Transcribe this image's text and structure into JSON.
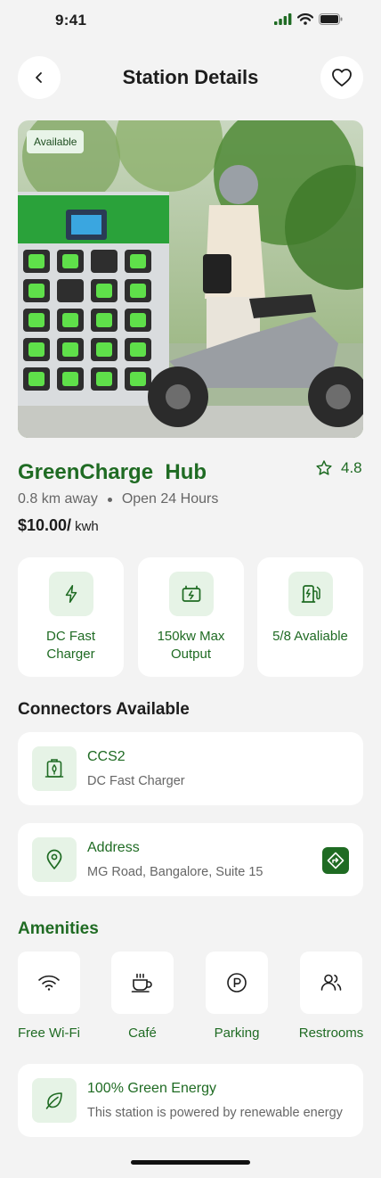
{
  "status_bar": {
    "time": "9:41"
  },
  "header": {
    "title": "Station Details"
  },
  "hero": {
    "badge": "Available"
  },
  "station": {
    "name": "GreenCharge  Hub",
    "rating": "4.8",
    "distance": "0.8 km away",
    "hours": "Open 24 Hours",
    "price": "$10.00/",
    "price_unit": "kwh"
  },
  "features": [
    {
      "icon": "lightning-icon",
      "label": "DC Fast Charger"
    },
    {
      "icon": "battery-icon",
      "label": "150kw Max Output"
    },
    {
      "icon": "ev-charger-icon",
      "label": "5/8 Avaliable"
    }
  ],
  "connectors": {
    "title": "Connectors Available",
    "items": [
      {
        "icon": "connector-icon",
        "name": "CCS2",
        "type": "DC Fast Charger"
      }
    ]
  },
  "address": {
    "label": "Address",
    "value": "MG Road, Bangalore, Suite 15"
  },
  "amenities": {
    "title": "Amenities",
    "items": [
      {
        "icon": "wifi-icon",
        "label": "Free Wi-Fi"
      },
      {
        "icon": "coffee-icon",
        "label": "Café"
      },
      {
        "icon": "parking-icon",
        "label": "Parking"
      },
      {
        "icon": "restroom-icon",
        "label": "Restrooms"
      }
    ]
  },
  "green_energy": {
    "title": "100% Green Energy",
    "desc": "This station is powered by renewable energy"
  },
  "colors": {
    "brand_green": "#1f6b23",
    "icon_bg": "#e6f3e6",
    "background": "#f3f3f3"
  }
}
